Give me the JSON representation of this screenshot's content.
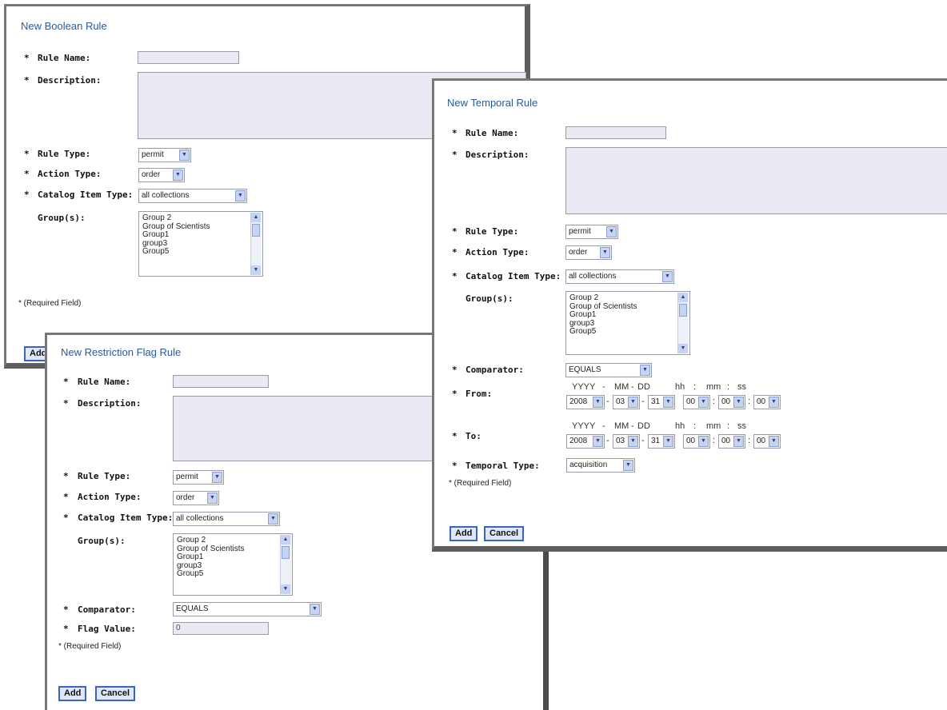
{
  "boolean": {
    "title": "New Boolean Rule",
    "required_marker": "*",
    "labels": {
      "rule_name": "Rule Name:",
      "description": "Description:",
      "rule_type": "Rule Type:",
      "action_type": "Action Type:",
      "catalog_item_type": "Catalog Item Type:",
      "groups": "Group(s):"
    },
    "values": {
      "rule_name": "",
      "rule_type": "permit",
      "action_type": "order",
      "catalog_item_type": "all collections"
    },
    "groups": [
      "Group 2",
      "Group of Scientists",
      "Group1",
      "group3",
      "Group5"
    ],
    "required_note": "* (Required Field)",
    "add_label": "Add"
  },
  "restriction": {
    "title": "New Restriction Flag Rule",
    "required_marker": "*",
    "labels": {
      "rule_name": "Rule Name:",
      "description": "Description:",
      "rule_type": "Rule Type:",
      "action_type": "Action Type:",
      "catalog_item_type": "Catalog Item Type:",
      "groups": "Group(s):",
      "comparator": "Comparator:",
      "flag_value": "Flag Value:"
    },
    "values": {
      "rule_name": "",
      "rule_type": "permit",
      "action_type": "order",
      "catalog_item_type": "all collections",
      "comparator": "EQUALS",
      "flag_value": "0"
    },
    "groups": [
      "Group 2",
      "Group of Scientists",
      "Group1",
      "group3",
      "Group5"
    ],
    "required_note": "* (Required Field)",
    "add_label": "Add",
    "cancel_label": "Cancel"
  },
  "temporal": {
    "title": "New Temporal Rule",
    "required_marker": "*",
    "labels": {
      "rule_name": "Rule Name:",
      "description": "Description:",
      "rule_type": "Rule Type:",
      "action_type": "Action Type:",
      "catalog_item_type": "Catalog Item Type:",
      "groups": "Group(s):",
      "comparator": "Comparator:",
      "from": "From:",
      "to": "To:",
      "temporal_type": "Temporal Type:"
    },
    "values": {
      "rule_name": "",
      "rule_type": "permit",
      "action_type": "order",
      "catalog_item_type": "all collections",
      "comparator": "EQUALS",
      "temporal_type": "acquisition"
    },
    "groups": [
      "Group 2",
      "Group of Scientists",
      "Group1",
      "group3",
      "Group5"
    ],
    "date_headers": {
      "yyyy": "YYYY",
      "mm": "MM",
      "dd": "DD",
      "hh": "hh",
      "mi": "mm",
      "ss": "ss",
      "dash": "-",
      "colon": ":"
    },
    "from": {
      "year": "2008",
      "month": "03",
      "day": "31",
      "hour": "00",
      "minute": "00",
      "second": "00"
    },
    "to": {
      "year": "2008",
      "month": "03",
      "day": "31",
      "hour": "00",
      "minute": "00",
      "second": "00"
    },
    "required_note": "* (Required Field)",
    "add_label": "Add",
    "cancel_label": "Cancel"
  },
  "icons": {
    "dropdown": "chevron-down-icon",
    "scroll_up": "scroll-up-icon",
    "scroll_down": "scroll-down-icon"
  }
}
